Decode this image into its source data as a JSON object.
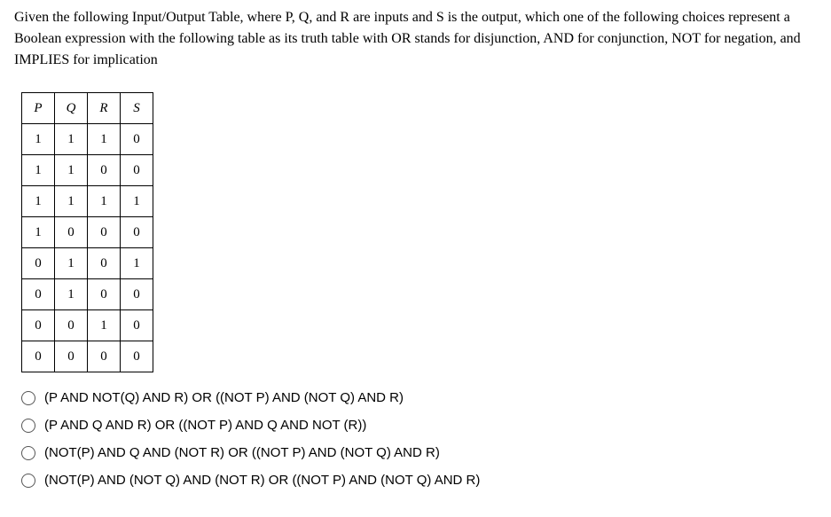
{
  "question": "Given the following Input/Output Table, where P, Q, and R are inputs and S is the output, which one of the following choices represent a Boolean expression with the following table as its truth table with OR stands for disjunction, AND for conjunction, NOT for negation, and IMPLIES for implication",
  "table": {
    "headers": [
      "P",
      "Q",
      "R",
      "S"
    ],
    "rows": [
      [
        "1",
        "1",
        "1",
        "0"
      ],
      [
        "1",
        "1",
        "0",
        "0"
      ],
      [
        "1",
        "1",
        "1",
        "1"
      ],
      [
        "1",
        "0",
        "0",
        "0"
      ],
      [
        "0",
        "1",
        "0",
        "1"
      ],
      [
        "0",
        "1",
        "0",
        "0"
      ],
      [
        "0",
        "0",
        "1",
        "0"
      ],
      [
        "0",
        "0",
        "0",
        "0"
      ]
    ]
  },
  "choices": [
    "(P AND NOT(Q) AND R) OR ((NOT P) AND (NOT Q) AND R)",
    "(P AND Q AND R) OR ((NOT P) AND Q AND NOT (R))",
    "(NOT(P) AND Q AND (NOT R) OR ((NOT P) AND (NOT Q) AND R)",
    "(NOT(P) AND (NOT Q) AND (NOT R) OR ((NOT P) AND (NOT Q) AND R)"
  ]
}
